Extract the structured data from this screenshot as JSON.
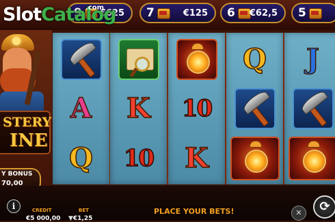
{
  "watermark": {
    "part1": "Slot",
    "part2": "Catalog",
    "suffix": ".com"
  },
  "paytable": [
    {
      "count": "9",
      "amount": "€625"
    },
    {
      "count": "7",
      "amount": "€125"
    },
    {
      "count": "6",
      "amount": "€62,5"
    },
    {
      "count": "5",
      "amount": ""
    }
  ],
  "game_logo": {
    "line1": "STERY",
    "line2": "INE"
  },
  "bonus": {
    "label": "Y BONUS",
    "value": "70,00"
  },
  "reels": [
    [
      "pickaxe",
      "A",
      "Q"
    ],
    [
      "map",
      "K",
      "10"
    ],
    [
      "lantern",
      "10",
      "K"
    ],
    [
      "Q",
      "pickaxe",
      "lantern"
    ],
    [
      "J",
      "pickaxe",
      "lantern"
    ]
  ],
  "bottom": {
    "credit_label": "CREDIT",
    "credit_value": "€5 000,00",
    "bet_label": "BET",
    "bet_value": "€1,25",
    "message": "PLACE YOUR BETS!"
  },
  "icons": {
    "info": "i",
    "spin": "⟳",
    "turbo": "✕",
    "bet_down": "▼",
    "bet_up": "▲"
  },
  "colors": {
    "accent": "#f2a020",
    "reel_bg": "#6fb0c8",
    "logo_green": "#3db04a"
  }
}
